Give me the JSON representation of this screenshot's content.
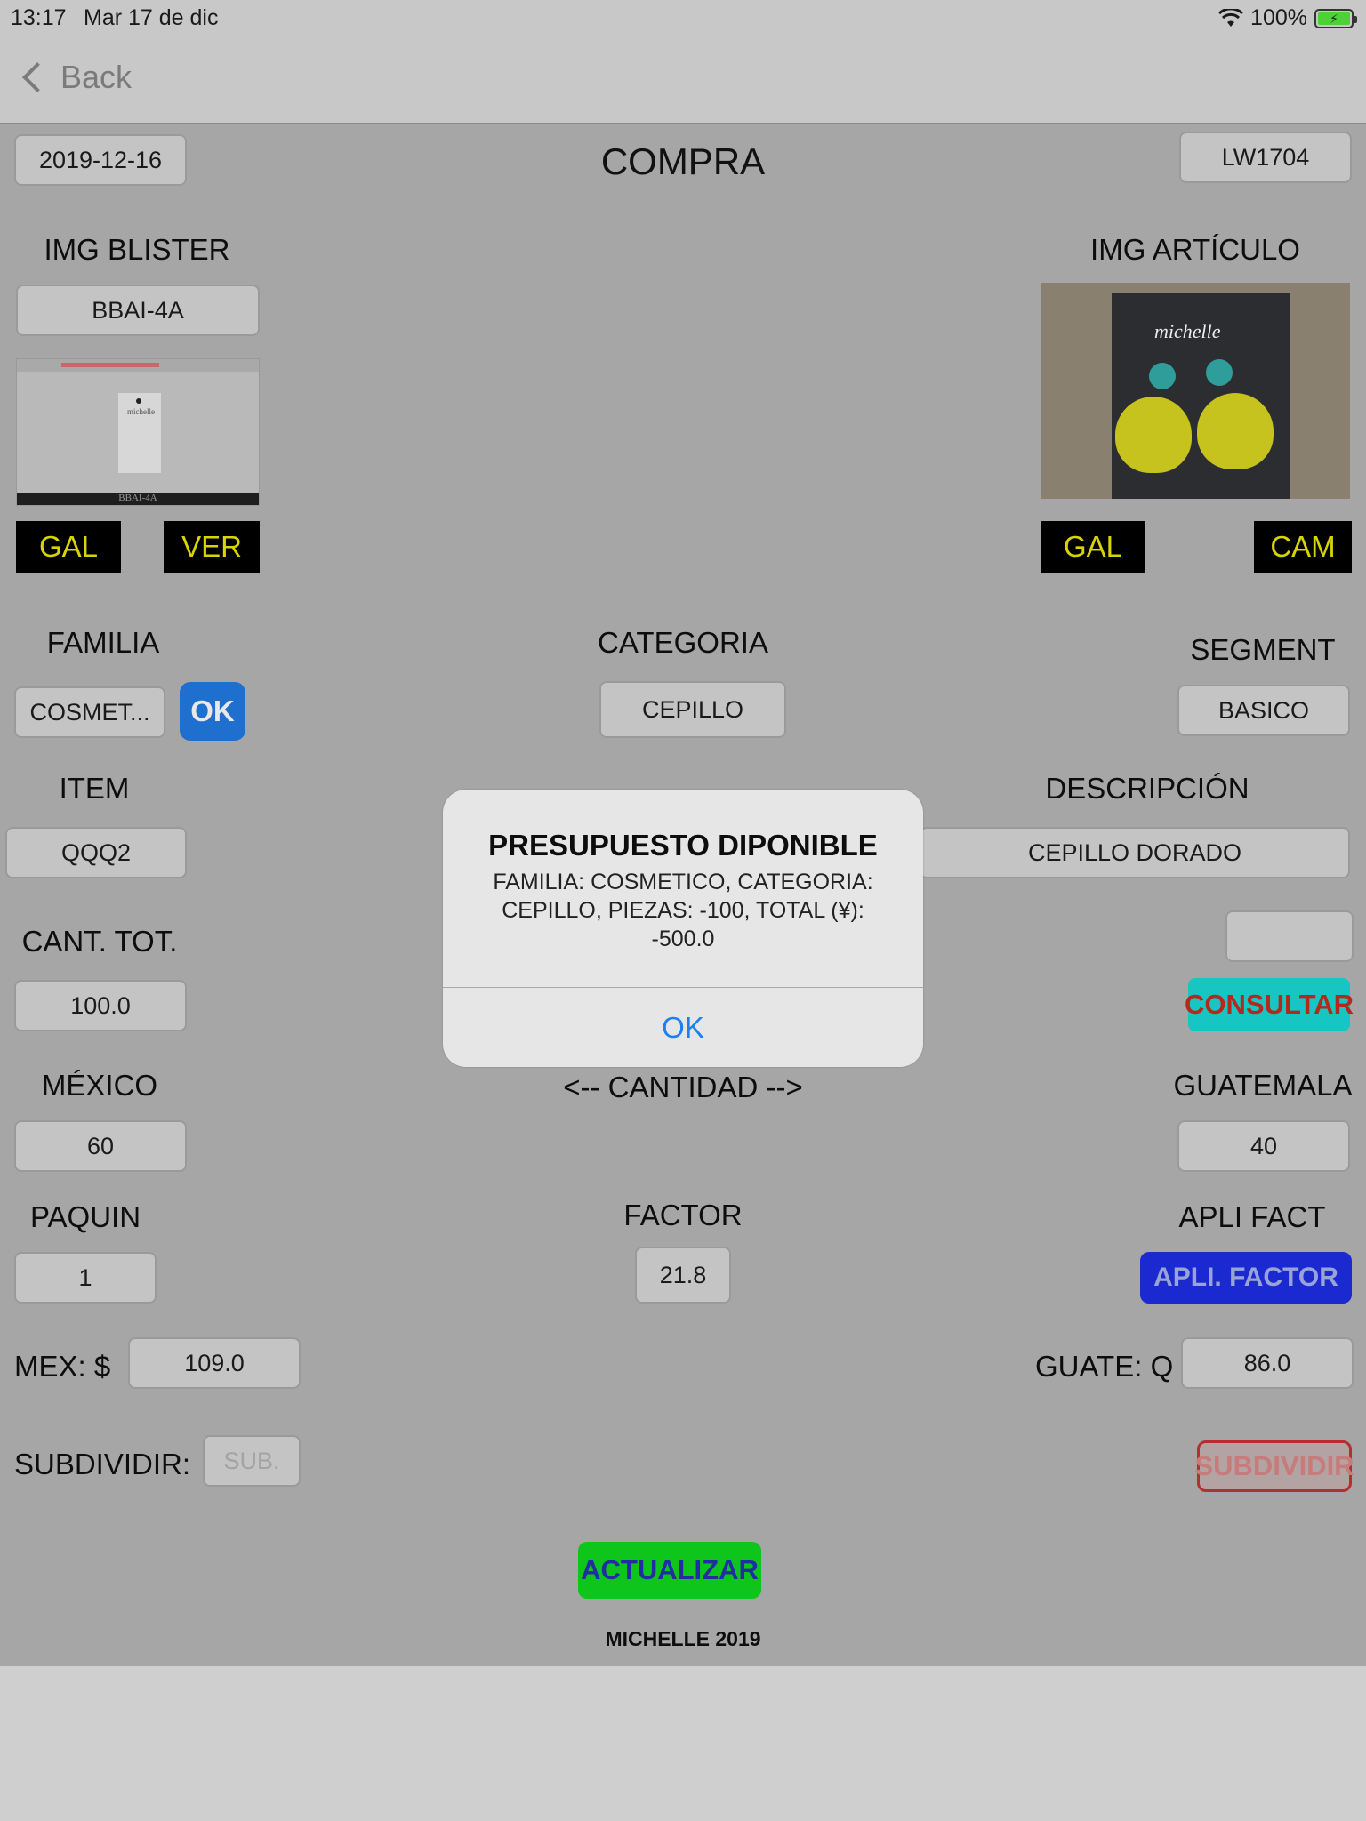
{
  "status_bar": {
    "time": "13:17",
    "date": "Mar 17 de dic",
    "battery": "100%"
  },
  "nav": {
    "back_label": "Back"
  },
  "header": {
    "date": "2019-12-16",
    "title": "COMPRA",
    "code": "LW1704"
  },
  "blister": {
    "label": "IMG BLISTER",
    "code": "BBAI-4A",
    "thumb_caption": "BBAI-4A",
    "thumb_brand": "michelle",
    "gal_label": "GAL",
    "ver_label": "VER"
  },
  "articulo": {
    "label": "IMG ARTÍCULO",
    "brand": "michelle",
    "gal_label": "GAL",
    "cam_label": "CAM"
  },
  "familia": {
    "label": "FAMILIA",
    "value": "COSMET...",
    "ok_label": "OK"
  },
  "categoria": {
    "label": "CATEGORIA",
    "value": "CEPILLO"
  },
  "segment": {
    "label": "SEGMENT",
    "value": "BASICO"
  },
  "item": {
    "label": "ITEM",
    "value": "QQQ2"
  },
  "descripcion": {
    "label": "DESCRIPCIÓN",
    "value": "CEPILLO DORADO"
  },
  "cant_tot": {
    "label": "CANT. TOT.",
    "value": "100.0"
  },
  "consultar_label": "CONSULTAR",
  "mexico": {
    "label": "MÉXICO",
    "value": "60"
  },
  "cantidad_label": "<-- CANTIDAD -->",
  "guatemala": {
    "label": "GUATEMALA",
    "value": "40"
  },
  "paquin": {
    "label": "PAQUIN",
    "value": "1"
  },
  "factor": {
    "label": "FACTOR",
    "value": "21.8"
  },
  "apli_fact": {
    "label": "APLI FACT",
    "button_label": "APLI. FACTOR"
  },
  "mex": {
    "label": "MEX: $",
    "value": "109.0"
  },
  "guate": {
    "label": "GUATE: Q",
    "value": "86.0"
  },
  "subdividir": {
    "label": "SUBDIVIDIR:",
    "placeholder": "SUB.",
    "button_label": "SUBDIVIDIR"
  },
  "actualizar_label": "ACTUALIZAR",
  "footer": "MICHELLE 2019",
  "alert": {
    "title": "PRESUPUESTO DIPONIBLE",
    "message": "FAMILIA: COSMETICO, CATEGORIA: CEPILLO, PIEZAS: -100, TOTAL (¥): -500.0",
    "ok_label": "OK"
  },
  "colors": {
    "overlay_bg": "#a6a6a6",
    "alert_button": "#1d7ff0",
    "consultar_bg": "#17c6c3",
    "actualizar_bg": "#0ec51b",
    "apli_bg": "#1b2ad0"
  }
}
